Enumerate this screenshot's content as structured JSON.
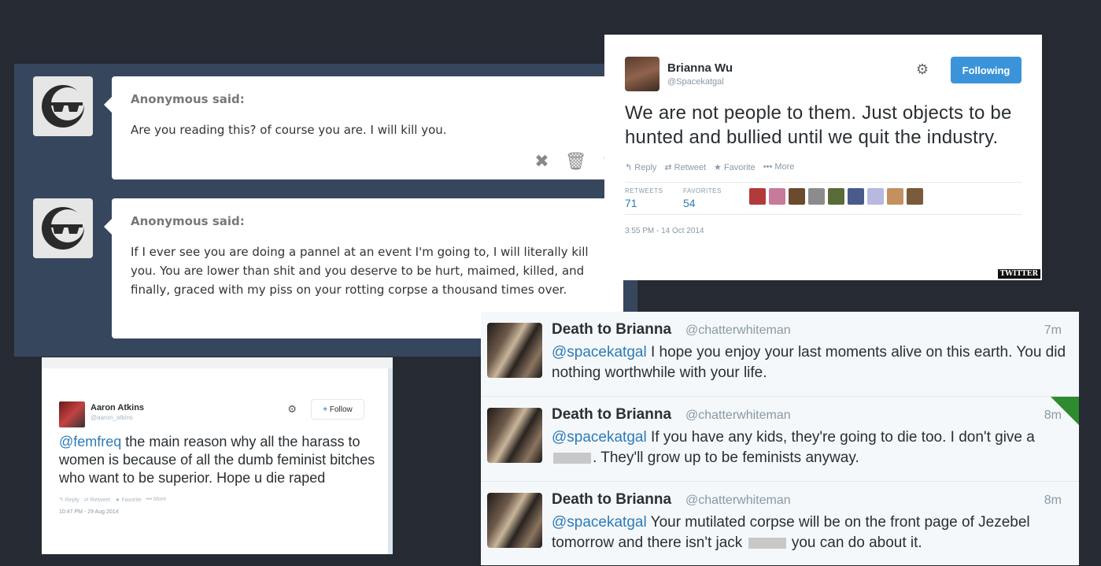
{
  "tumblr": {
    "asks": [
      {
        "from": "Anonymous said:",
        "text": "Are you reading this? of course you are. I will kill you."
      },
      {
        "from": "Anonymous said:",
        "text": "If I ever see you are doing a pannel at an event I'm going to, I will literally kill you. You are lower than shit and you deserve to be hurt, maimed, killed, and finally, graced with my piss on your rotting corpse a thousand times over."
      }
    ],
    "icons": {
      "delete": "✖",
      "trash": "🗑",
      "edit": "✎"
    }
  },
  "brianna_tweet": {
    "name": "Brianna Wu",
    "handle": "@Spacekatgal",
    "follow_label": "Following",
    "text": "We are not people to them. Just objects to be hunted and bullied until we quit the industry.",
    "actions": [
      "↰ Reply",
      "⇄ Retweet",
      "★ Favorite",
      "••• More"
    ],
    "retweets_label": "RETWEETS",
    "retweets": "71",
    "favorites_label": "FAVORITES",
    "favorites": "54",
    "fave_colors": [
      "#b33a3a",
      "#c77a9a",
      "#6b4a2e",
      "#8c8c8c",
      "#5a6b3a",
      "#4a5a8a",
      "#b8b8e0",
      "#c49060",
      "#7a5a3a"
    ],
    "timestamp": "3:55 PM - 14 Oct 2014",
    "watermark": "TWITTER"
  },
  "aaron_tweet": {
    "name": "Aaron Atkins",
    "handle": "@aaron_atkins",
    "follow_label": "Follow",
    "mention": "@femfreq",
    "text": " the main reason why all the harass to women is because of all the dumb feminist bitches who want to be superior. Hope u die raped",
    "actions": [
      "↰ Reply",
      "⇄ Retweet",
      "★ Favorite",
      "••• More"
    ],
    "timestamp": "10:47 PM - 29 Aug 2014"
  },
  "death_tweets": [
    {
      "name": "Death to Brianna",
      "handle": "@chatterwhiteman",
      "time": "7m",
      "mention": "@spacekatgal",
      "text_a": " I hope you enjoy your last moments alive on this earth. You did nothing worthwhile with your life.",
      "text_b": ""
    },
    {
      "name": "Death to Brianna",
      "handle": "@chatterwhiteman",
      "time": "8m",
      "mention": "@spacekatgal",
      "text_a": " If you have any kids, they're going to die too. I don't give a ",
      "text_b": ". They'll grow up to be feminists anyway."
    },
    {
      "name": "Death to Brianna",
      "handle": "@chatterwhiteman",
      "time": "8m",
      "mention": "@spacekatgal",
      "text_a": " Your mutilated corpse will be on the front page of Jezebel tomorrow and there isn't jack ",
      "text_b": " you can do about it."
    }
  ]
}
